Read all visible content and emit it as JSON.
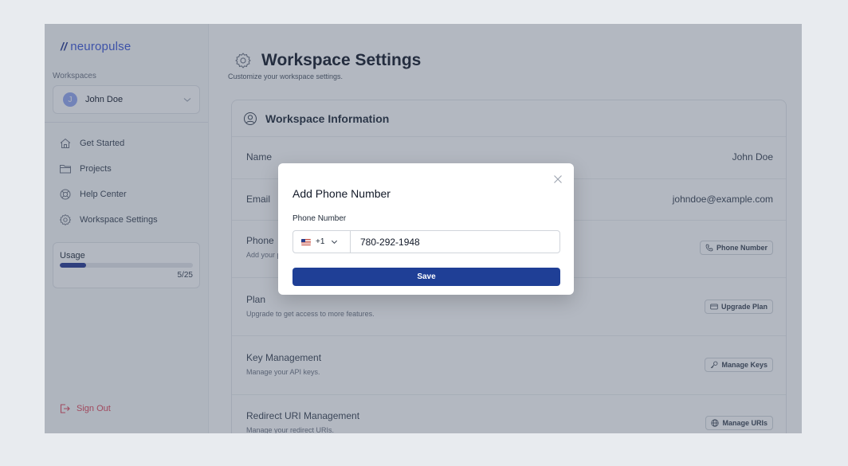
{
  "brand": {
    "name": "neuropulse",
    "mark": "//"
  },
  "sidebar": {
    "workspaces_label": "Workspaces",
    "workspace": {
      "avatar_initial": "J",
      "name": "John Doe"
    },
    "nav": [
      {
        "label": "Get Started",
        "icon": "home-icon"
      },
      {
        "label": "Projects",
        "icon": "folder-icon"
      },
      {
        "label": "Help Center",
        "icon": "lifebuoy-icon"
      },
      {
        "label": "Workspace Settings",
        "icon": "gear-icon"
      }
    ],
    "usage": {
      "label": "Usage",
      "count": "5/25",
      "fraction": 0.2
    },
    "sign_out": "Sign Out"
  },
  "page": {
    "title": "Workspace Settings",
    "subtitle": "Customize your workspace settings."
  },
  "card": {
    "title": "Workspace Information",
    "rows": {
      "name": {
        "title": "Name",
        "value": "John Doe"
      },
      "email": {
        "title": "Email",
        "value": "johndoe@example.com"
      },
      "phone": {
        "title": "Phone",
        "desc": "Add your p",
        "button": "Phone Number"
      },
      "plan": {
        "title": "Plan",
        "desc": "Upgrade to get access to more features.",
        "button": "Upgrade Plan"
      },
      "keys": {
        "title": "Key Management",
        "desc": "Manage your API keys.",
        "button": "Manage Keys"
      },
      "uris": {
        "title": "Redirect URI Management",
        "desc": "Manage your redirect URIs.",
        "button": "Manage URIs"
      }
    }
  },
  "modal": {
    "title": "Add Phone Number",
    "field_label": "Phone Number",
    "country_code": "+1",
    "phone_value": "780-292-1948",
    "save_label": "Save"
  },
  "colors": {
    "brand": "#3b55d6",
    "primary_button": "#1f3f96",
    "sign_out": "#e0475a",
    "overlay": "rgba(66,77,99,0.40)"
  }
}
